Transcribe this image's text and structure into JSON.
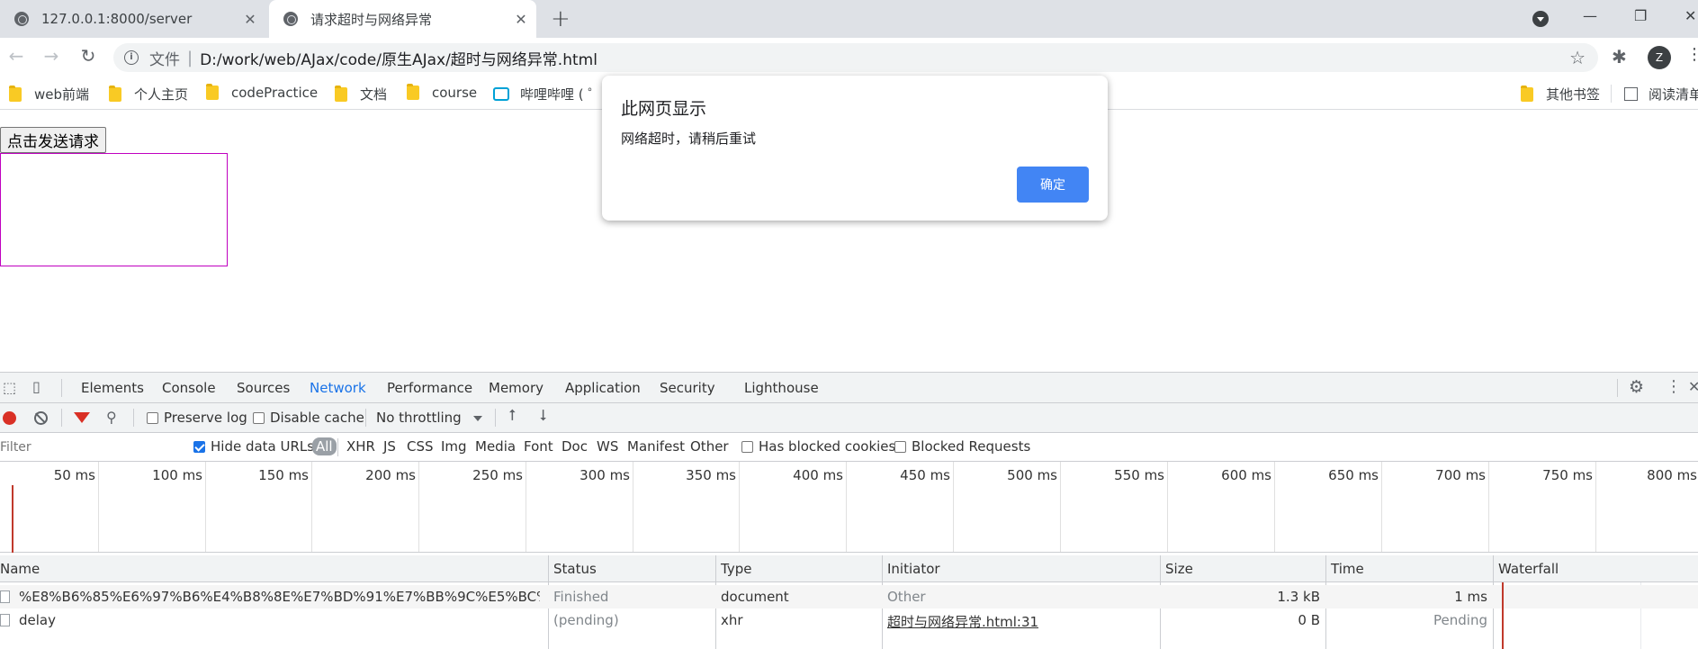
{
  "tabs": [
    {
      "title": "127.0.0.1:8000/server",
      "active": false
    },
    {
      "title": "请求超时与网络异常",
      "active": true
    }
  ],
  "toolbar": {
    "omni_label": "文件",
    "url": "D:/work/web/AJax/code/原生AJax/超时与网络异常.html",
    "avatar_letter": "Z"
  },
  "bookmarks": [
    {
      "label": "web前端",
      "icon": "folder-icon"
    },
    {
      "label": "个人主页",
      "icon": "folder-icon"
    },
    {
      "label": "codePractice",
      "icon": "folder-icon"
    },
    {
      "label": "文档",
      "icon": "folder-icon"
    },
    {
      "label": "course",
      "icon": "folder-icon"
    },
    {
      "label": "哔哩哔哩 ( ゜-",
      "icon": "bilibili-icon"
    },
    {
      "label": "其他书签",
      "icon": "folder-icon"
    },
    {
      "label": "阅读清单",
      "icon": "reading-list-icon"
    }
  ],
  "page": {
    "button_label": "点击发送请求"
  },
  "alert": {
    "title": "此网页显示",
    "message": "网络超时，请稍后重试",
    "ok_label": "确定"
  },
  "devtools": {
    "tabs": [
      "Elements",
      "Console",
      "Sources",
      "Network",
      "Performance",
      "Memory",
      "Application",
      "Security",
      "Lighthouse"
    ],
    "active_tab": "Network",
    "toolbar": {
      "preserve_log": "Preserve log",
      "disable_cache": "Disable cache",
      "throttling": "No throttling"
    },
    "filter": {
      "placeholder": "Filter",
      "hide_data_urls": "Hide data URLs",
      "types": [
        "All",
        "XHR",
        "JS",
        "CSS",
        "Img",
        "Media",
        "Font",
        "Doc",
        "WS",
        "Manifest",
        "Other"
      ],
      "active_type": "All",
      "blocked_cookies": "Has blocked cookies",
      "blocked_requests": "Blocked Requests"
    },
    "timeline_ticks": [
      "50 ms",
      "100 ms",
      "150 ms",
      "200 ms",
      "250 ms",
      "300 ms",
      "350 ms",
      "400 ms",
      "450 ms",
      "500 ms",
      "550 ms",
      "600 ms",
      "650 ms",
      "700 ms",
      "750 ms",
      "800 ms"
    ],
    "columns": [
      "Name",
      "Status",
      "Type",
      "Initiator",
      "Size",
      "Time",
      "Waterfall"
    ],
    "requests": [
      {
        "name": "%E8%B6%85%E6%97%B6%E4%B8%8E%E7%BD%91%E7%BB%9C%E5%BC%82%E5%B...",
        "status": "Finished",
        "type": "document",
        "initiator": "Other",
        "size": "1.3 kB",
        "time": "1 ms"
      },
      {
        "name": "delay",
        "status": "(pending)",
        "type": "xhr",
        "initiator": "超时与网络异常.html:31",
        "size": "0 B",
        "time": "Pending"
      }
    ]
  }
}
